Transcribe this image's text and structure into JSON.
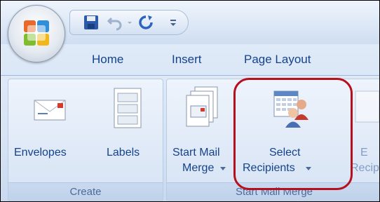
{
  "tabs": [
    {
      "label": "Home"
    },
    {
      "label": "Insert"
    },
    {
      "label": "Page Layout"
    }
  ],
  "quick_access": {
    "items": [
      "save-icon",
      "undo-icon",
      "redo-icon",
      "customize-icon"
    ]
  },
  "ribbon": {
    "groups": [
      {
        "label": "Create",
        "buttons": [
          {
            "label": "Envelopes",
            "icon": "envelope-icon"
          },
          {
            "label": "Labels",
            "icon": "labels-icon"
          }
        ]
      },
      {
        "label": "Start Mail Merge",
        "buttons": [
          {
            "label_line1": "Start Mail",
            "label_line2": "Merge",
            "icon": "start-mail-merge-icon"
          },
          {
            "label_line1": "Select",
            "label_line2": "Recipients",
            "icon": "select-recipients-icon"
          },
          {
            "label_line1": "E",
            "label_line2": "Recip",
            "icon": "edit-recipients-icon"
          }
        ]
      }
    ]
  },
  "colors": {
    "tab_text": "#15428b",
    "highlight": "#b5101d"
  }
}
